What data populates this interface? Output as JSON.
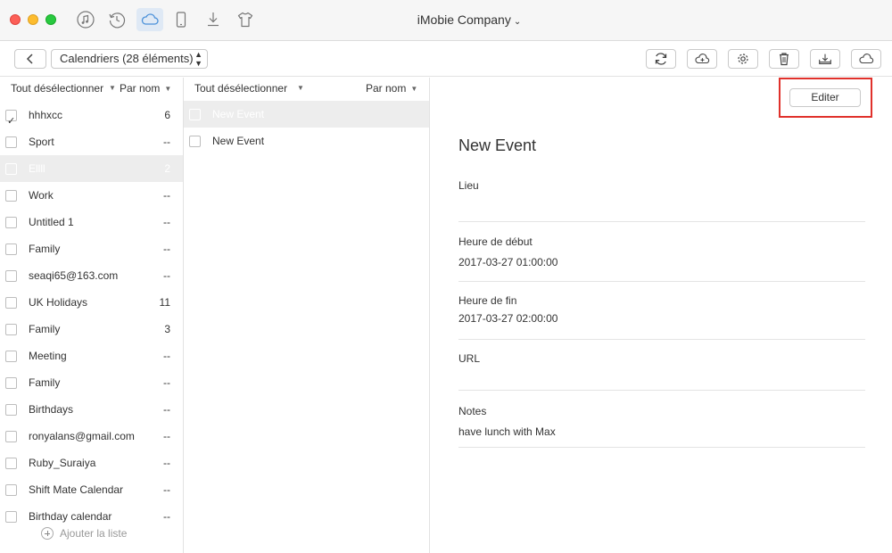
{
  "titlebar": {
    "app_title": "iMobie Company",
    "nav_icons": [
      "music-icon",
      "history-icon",
      "cloud-icon",
      "phone-icon",
      "download-icon",
      "tshirt-icon"
    ],
    "active_icon": "cloud-icon"
  },
  "toolbar": {
    "category_select": "Calendriers (28 éléments)",
    "actions": [
      "sync-icon",
      "cloud-upload-icon",
      "gear-icon",
      "trash-icon",
      "export-icon",
      "cloud-icon"
    ]
  },
  "calendars": {
    "select_label": "Tout désélectionner",
    "sort_label": "Par nom",
    "items": [
      {
        "label": "hhhxcc",
        "count": "6",
        "checked": true,
        "selected": false
      },
      {
        "label": "Sport",
        "count": "--",
        "checked": false,
        "selected": false
      },
      {
        "label": "Ellll",
        "count": "2",
        "checked": false,
        "selected": true
      },
      {
        "label": "Work",
        "count": "--",
        "checked": false,
        "selected": false
      },
      {
        "label": "Untitled 1",
        "count": "--",
        "checked": false,
        "selected": false
      },
      {
        "label": "Family",
        "count": "--",
        "checked": false,
        "selected": false
      },
      {
        "label": "seaqi65@163.com",
        "count": "--",
        "checked": false,
        "selected": false
      },
      {
        "label": "UK Holidays",
        "count": "11",
        "checked": false,
        "selected": false
      },
      {
        "label": "Family",
        "count": "3",
        "checked": false,
        "selected": false
      },
      {
        "label": "Meeting",
        "count": "--",
        "checked": false,
        "selected": false
      },
      {
        "label": "Family",
        "count": "--",
        "checked": false,
        "selected": false
      },
      {
        "label": "Birthdays",
        "count": "--",
        "checked": false,
        "selected": false
      },
      {
        "label": "ronyalans@gmail.com",
        "count": "--",
        "checked": false,
        "selected": false
      },
      {
        "label": "Ruby_Suraiya",
        "count": "--",
        "checked": false,
        "selected": false
      },
      {
        "label": "Shift Mate Calendar",
        "count": "--",
        "checked": false,
        "selected": false
      },
      {
        "label": "Birthday calendar",
        "count": "--",
        "checked": false,
        "selected": false
      }
    ],
    "add_list_label": "Ajouter la liste"
  },
  "events": {
    "select_label": "Tout désélectionner",
    "sort_label": "Par nom",
    "items": [
      {
        "label": "New Event",
        "selected": true
      },
      {
        "label": "New Event",
        "selected": false
      }
    ]
  },
  "detail": {
    "edit_label": "Editer",
    "title": "New Event",
    "location_label": "Lieu",
    "location_value": "",
    "start_label": "Heure de début",
    "start_value": "2017-03-27 01:00:00",
    "end_label": "Heure de fin",
    "end_value": "2017-03-27 02:00:00",
    "url_label": "URL",
    "url_value": "",
    "notes_label": "Notes",
    "notes_value": "have lunch with Max"
  },
  "colors": {
    "highlight": "#e0312b",
    "active_nav_bg": "#dfe9f5",
    "selected_row_bg": "#ededed"
  }
}
